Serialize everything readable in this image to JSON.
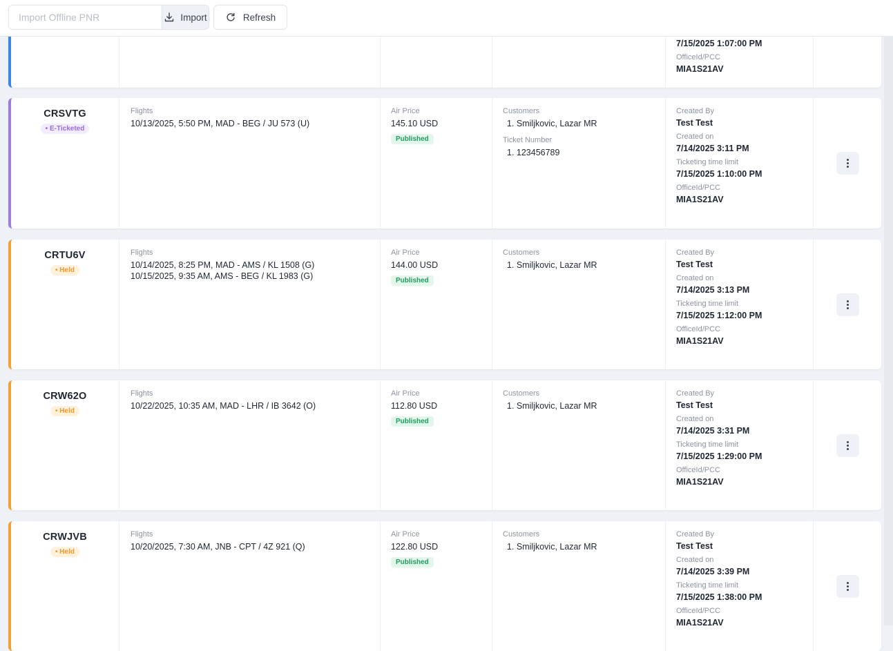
{
  "toolbar": {
    "search_placeholder": "Import Offline PNR",
    "import_label": "Import",
    "refresh_label": "Refresh"
  },
  "labels": {
    "flights": "Flights",
    "air_price": "Air Price",
    "customers": "Customers",
    "ticket_number": "Ticket Number",
    "created_by": "Created By",
    "created_on": "Created on",
    "ticketing_time_limit": "Ticketing time limit",
    "office_id": "OfficeId/PCC"
  },
  "partial_card": {
    "ticketing_time_limit": "7/15/2025 1:07:00 PM",
    "office_id": "MIA1S21AV",
    "accent": "#3a86e0"
  },
  "bookings": [
    {
      "pnr": "CRSVTG",
      "status": "E-Ticketed",
      "status_type": "eticket",
      "accent": "#9b7fdc",
      "flights": [
        "10/13/2025, 5:50 PM, MAD - BEG / JU 573 (U)"
      ],
      "price": "145.10 USD",
      "price_status": "Published",
      "customers": [
        "1. Smiljkovic, Lazar MR"
      ],
      "ticket_numbers": [
        "1. 123456789"
      ],
      "created_by": "Test Test",
      "created_on": "7/14/2025 3:11 PM",
      "ticketing_time_limit": "7/15/2025 1:10:00 PM",
      "office_id": "MIA1S21AV"
    },
    {
      "pnr": "CRTU6V",
      "status": "Held",
      "status_type": "held",
      "accent": "#f0a23a",
      "flights": [
        "10/14/2025, 8:25 PM, MAD - AMS / KL 1508 (G)",
        "10/15/2025, 9:35 AM, AMS - BEG / KL 1983 (G)"
      ],
      "price": "144.00 USD",
      "price_status": "Published",
      "customers": [
        "1. Smiljkovic, Lazar MR"
      ],
      "ticket_numbers": [],
      "created_by": "Test Test",
      "created_on": "7/14/2025 3:13 PM",
      "ticketing_time_limit": "7/15/2025 1:12:00 PM",
      "office_id": "MIA1S21AV"
    },
    {
      "pnr": "CRW62O",
      "status": "Held",
      "status_type": "held",
      "accent": "#f0a23a",
      "flights": [
        "10/22/2025, 10:35 AM, MAD - LHR / IB 3642 (O)"
      ],
      "price": "112.80 USD",
      "price_status": "Published",
      "customers": [
        "1. Smiljkovic, Lazar MR"
      ],
      "ticket_numbers": [],
      "created_by": "Test Test",
      "created_on": "7/14/2025 3:31 PM",
      "ticketing_time_limit": "7/15/2025 1:29:00 PM",
      "office_id": "MIA1S21AV"
    },
    {
      "pnr": "CRWJVB",
      "status": "Held",
      "status_type": "held",
      "accent": "#f0a23a",
      "flights": [
        "10/20/2025, 7:30 AM, JNB - CPT / 4Z 921 (Q)"
      ],
      "price": "122.80 USD",
      "price_status": "Published",
      "customers": [
        "1. Smiljkovic, Lazar MR"
      ],
      "ticket_numbers": [],
      "created_by": "Test Test",
      "created_on": "7/14/2025 3:39 PM",
      "ticketing_time_limit": "7/15/2025 1:38:00 PM",
      "office_id": "MIA1S21AV"
    }
  ]
}
